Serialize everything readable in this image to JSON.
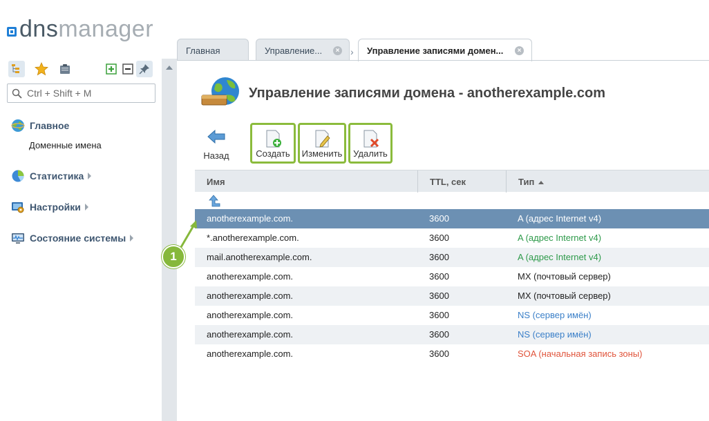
{
  "logo": {
    "dns": "dns",
    "manager": "manager"
  },
  "sidebar": {
    "search_placeholder": "Ctrl + Shift + M",
    "nav": [
      {
        "label": "Главное",
        "icon": "globe-icon",
        "sub": [
          "Доменные имена"
        ]
      },
      {
        "label": "Статистика",
        "icon": "pie-chart-icon"
      },
      {
        "label": "Настройки",
        "icon": "settings-icon"
      },
      {
        "label": "Состояние системы",
        "icon": "monitor-icon"
      }
    ]
  },
  "tabs": [
    {
      "label": "Главная"
    },
    {
      "label": "Управление..."
    },
    {
      "label": "Управление записями домен..."
    }
  ],
  "page": {
    "title": "Управление записями домена - anotherexample.com"
  },
  "toolbar": {
    "back": "Назад",
    "create": "Создать",
    "edit": "Изменить",
    "delete": "Удалить"
  },
  "table": {
    "columns": [
      "Имя",
      "TTL, сек",
      "Тип"
    ],
    "rows": [
      {
        "name": "anotherexample.com.",
        "ttl": "3600",
        "type": "A (адрес Internet v4)",
        "type_color": "#ffffff",
        "selected": true
      },
      {
        "name": "*.anotherexample.com.",
        "ttl": "3600",
        "type": "A (адрес Internet v4)",
        "type_color": "#2e9a4a"
      },
      {
        "name": "mail.anotherexample.com.",
        "ttl": "3600",
        "type": "A (адрес Internet v4)",
        "type_color": "#2e9a4a"
      },
      {
        "name": "anotherexample.com.",
        "ttl": "3600",
        "type": "MX (почтовый сервер)",
        "type_color": "#222222"
      },
      {
        "name": "anotherexample.com.",
        "ttl": "3600",
        "type": "MX (почтовый сервер)",
        "type_color": "#222222"
      },
      {
        "name": "anotherexample.com.",
        "ttl": "3600",
        "type": "NS (сервер имён)",
        "type_color": "#3a7fc8"
      },
      {
        "name": "anotherexample.com.",
        "ttl": "3600",
        "type": "NS (сервер имён)",
        "type_color": "#3a7fc8"
      },
      {
        "name": "anotherexample.com.",
        "ttl": "3600",
        "type": "SOA (начальная запись зоны)",
        "type_color": "#e0533a"
      }
    ]
  },
  "callout": {
    "number": "1"
  },
  "colors": {
    "accent_green": "#8bbb3c",
    "selected_row": "#6c90b3",
    "nav_text": "#3e5670"
  }
}
